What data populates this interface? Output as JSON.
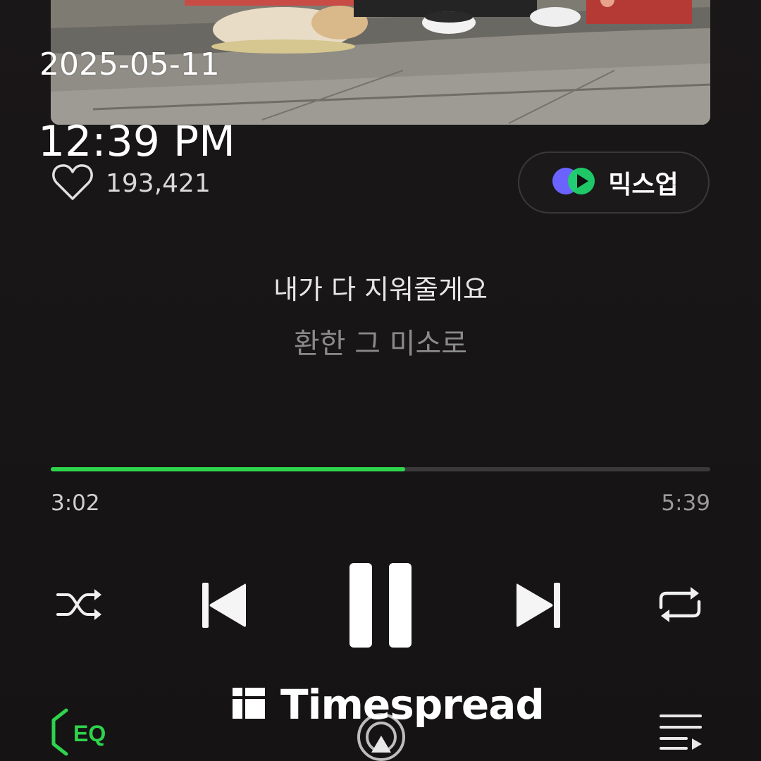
{
  "overlay": {
    "date": "2025-05-11",
    "time": "12:39 PM"
  },
  "player": {
    "like_count": "193,421",
    "mixup_label": "믹스업",
    "lyrics": {
      "current": "내가 다 지워줄게요",
      "next": "환한 그 미소로"
    },
    "progress": {
      "elapsed": "3:02",
      "total": "5:39",
      "fraction": 0.537
    },
    "controls": {
      "shuffle": "shuffle-icon",
      "previous": "skip-previous-icon",
      "play_pause": "pause-icon",
      "next": "skip-next-icon",
      "repeat": "repeat-icon"
    },
    "bottom": {
      "eq_label": "EQ"
    }
  },
  "colors": {
    "accent": "#2ed44b",
    "background": "#161415",
    "track": "#3b393a"
  },
  "watermark": {
    "text": "Timespread"
  }
}
